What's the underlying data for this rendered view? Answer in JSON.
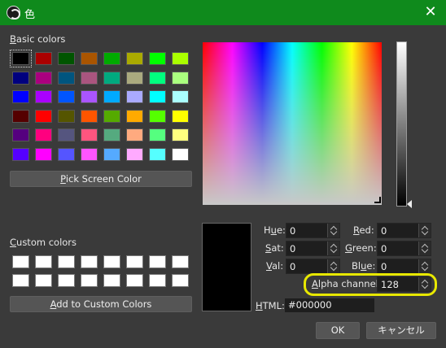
{
  "window": {
    "title": "色",
    "close_glyph": "✕",
    "titlebar_color": "#0f8a1c"
  },
  "basic_colors": {
    "label_first": "B",
    "label_rest": "asic colors",
    "rows": [
      [
        "#000000",
        "#aa0000",
        "#005500",
        "#aa5500",
        "#00aa00",
        "#aaaa00",
        "#00ff00",
        "#aaff00"
      ],
      [
        "#00007f",
        "#aa007f",
        "#00557f",
        "#aa557f",
        "#00aa7f",
        "#aaaa7f",
        "#00ff7f",
        "#aaff7f"
      ],
      [
        "#0000ff",
        "#aa00ff",
        "#0055ff",
        "#aa55ff",
        "#00aaff",
        "#aaaaff",
        "#00ffff",
        "#aaffff"
      ],
      [
        "#550000",
        "#ff0000",
        "#555500",
        "#ff5500",
        "#55aa00",
        "#ffaa00",
        "#55ff00",
        "#ffff00"
      ],
      [
        "#55007f",
        "#ff007f",
        "#55557f",
        "#ff557f",
        "#55aa7f",
        "#ffaa7f",
        "#55ff7f",
        "#ffff7f"
      ],
      [
        "#5500ff",
        "#ff00ff",
        "#5555ff",
        "#ff55ff",
        "#55aaff",
        "#ffaaff",
        "#55ffff",
        "#ffffff"
      ]
    ],
    "selected": "#000000"
  },
  "buttons": {
    "pick_first": "P",
    "pick_rest": "ick Screen Color",
    "add_first": "A",
    "add_rest": "dd to Custom Colors",
    "ok": "OK",
    "cancel": "キャンセル"
  },
  "custom_colors": {
    "label_first": "C",
    "label_rest": "ustom colors",
    "rows": [
      [
        "#ffffff",
        "#ffffff",
        "#ffffff",
        "#ffffff",
        "#ffffff",
        "#ffffff",
        "#ffffff",
        "#ffffff"
      ],
      [
        "#ffffff",
        "#ffffff",
        "#ffffff",
        "#ffffff",
        "#ffffff",
        "#ffffff",
        "#ffffff",
        "#ffffff"
      ]
    ]
  },
  "fields": {
    "hue": {
      "label_first": "u",
      "label_pre": "H",
      "label_post": "e:",
      "value": "0"
    },
    "sat": {
      "label_pre": "",
      "label_first": "S",
      "label_post": "at:",
      "value": "0"
    },
    "val": {
      "label_pre": "",
      "label_first": "V",
      "label_post": "al:",
      "value": "0"
    },
    "red": {
      "label_pre": "",
      "label_first": "R",
      "label_post": "ed:",
      "value": "0"
    },
    "green": {
      "label_pre": "",
      "label_first": "G",
      "label_post": "reen:",
      "value": "0"
    },
    "blue": {
      "label_pre": "Bl",
      "label_first": "u",
      "label_post": "e:",
      "value": "0"
    },
    "alpha": {
      "label_pre": "",
      "label_first": "A",
      "label_post": "lpha channel:",
      "value": "128"
    },
    "html": {
      "label_pre": "",
      "label_first": "H",
      "label_post": "TML:",
      "value": "#000000"
    }
  },
  "current_color": "#000000",
  "highlight_color": "#e8e800"
}
